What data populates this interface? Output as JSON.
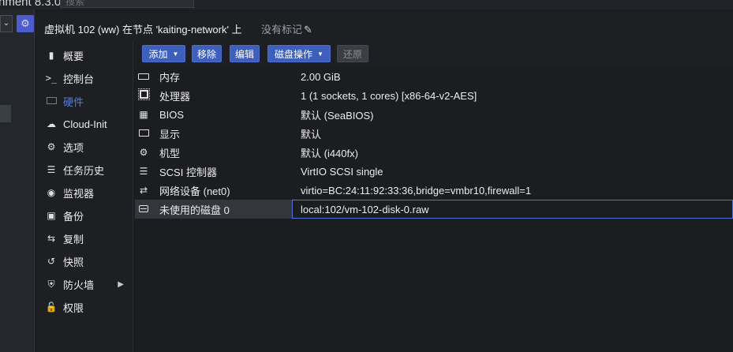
{
  "topbar": {
    "app_title": "nment 8.3.0",
    "search_placeholder": "搜索"
  },
  "header": {
    "vm_title": "虚拟机 102 (ww) 在节点 'kaiting-network' 上",
    "tags_label": "没有标记"
  },
  "nav": {
    "items": [
      {
        "label": "概要",
        "icon": "book-icon"
      },
      {
        "label": "控制台",
        "icon": "terminal-icon"
      },
      {
        "label": "硬件",
        "icon": "desktop-icon",
        "active": true
      },
      {
        "label": "Cloud-Init",
        "icon": "cloud-icon"
      },
      {
        "label": "选项",
        "icon": "gear-icon"
      },
      {
        "label": "任务历史",
        "icon": "list-icon"
      },
      {
        "label": "监视器",
        "icon": "eye-icon"
      },
      {
        "label": "备份",
        "icon": "floppy-icon"
      },
      {
        "label": "复制",
        "icon": "retweet-icon"
      },
      {
        "label": "快照",
        "icon": "history-icon"
      },
      {
        "label": "防火墙",
        "icon": "shield-icon"
      },
      {
        "label": "权限",
        "icon": "unlock-icon"
      }
    ]
  },
  "toolbar": {
    "add_label": "添加",
    "remove_label": "移除",
    "edit_label": "编辑",
    "disk_action_label": "磁盘操作",
    "revert_label": "还原"
  },
  "hardware": {
    "rows": [
      {
        "name": "内存",
        "value": "2.00 GiB",
        "icon": "memory-icon"
      },
      {
        "name": "处理器",
        "value": "1 (1 sockets, 1 cores) [x86-64-v2-AES]",
        "icon": "cpu-icon"
      },
      {
        "name": "BIOS",
        "value": "默认 (SeaBIOS)",
        "icon": "microchip-icon"
      },
      {
        "name": "显示",
        "value": "默认",
        "icon": "desktop-icon"
      },
      {
        "name": "机型",
        "value": "默认 (i440fx)",
        "icon": "cogs-icon"
      },
      {
        "name": "SCSI 控制器",
        "value": "VirtIO SCSI single",
        "icon": "database-icon"
      },
      {
        "name": "网络设备 (net0)",
        "value": "virtio=BC:24:11:92:33:36,bridge=vmbr10,firewall=1",
        "icon": "exchange-icon"
      },
      {
        "name": "未使用的磁盘 0",
        "value": "local:102/vm-102-disk-0.raw",
        "icon": "hdd-icon",
        "selected": true
      }
    ]
  },
  "colors": {
    "accent": "#3f5fbd",
    "active_nav": "#5b7cd6",
    "selection_border": "#4e74d8"
  }
}
